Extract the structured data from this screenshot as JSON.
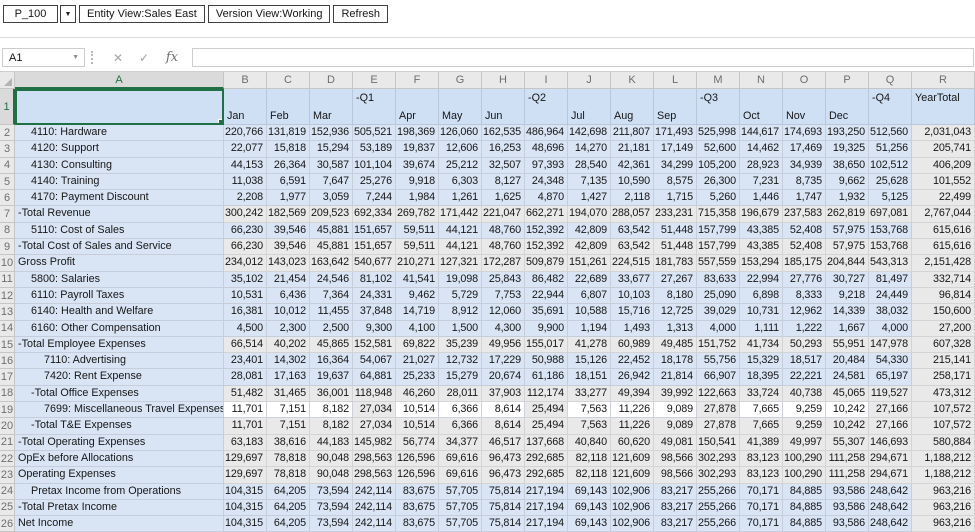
{
  "toolbar": {
    "pov": "P_100",
    "entity_button": "Entity View:Sales East",
    "version_button": "Version View:Working",
    "refresh_button": "Refresh"
  },
  "icons": {
    "pov_arrow": "▼",
    "namebox_arrow": "▼",
    "cancel": "✕",
    "confirm": "✓",
    "fx": "fx"
  },
  "formula_bar": {
    "cell_reference": "A1",
    "formula_value": ""
  },
  "colors": {
    "selection_green": "#1F7145",
    "fill_blue": "#D9E5F5",
    "fill_header_blue": "#CFE0F5",
    "fill_gray": "#E9E9E9",
    "fill_white": "#FFFFFF"
  },
  "grid": {
    "col_a": "A",
    "row1_number": "1",
    "columns": [
      {
        "letter": "B",
        "top": "",
        "bottom": "Jan"
      },
      {
        "letter": "C",
        "top": "",
        "bottom": "Feb"
      },
      {
        "letter": "D",
        "top": "",
        "bottom": "Mar"
      },
      {
        "letter": "E",
        "top": "-Q1",
        "bottom": ""
      },
      {
        "letter": "F",
        "top": "",
        "bottom": "Apr"
      },
      {
        "letter": "G",
        "top": "",
        "bottom": "May"
      },
      {
        "letter": "H",
        "top": "",
        "bottom": "Jun"
      },
      {
        "letter": "I",
        "top": "-Q2",
        "bottom": ""
      },
      {
        "letter": "J",
        "top": "",
        "bottom": "Jul"
      },
      {
        "letter": "K",
        "top": "",
        "bottom": "Aug"
      },
      {
        "letter": "L",
        "top": "",
        "bottom": "Sep"
      },
      {
        "letter": "M",
        "top": "-Q3",
        "bottom": ""
      },
      {
        "letter": "N",
        "top": "",
        "bottom": "Oct"
      },
      {
        "letter": "O",
        "top": "",
        "bottom": "Nov"
      },
      {
        "letter": "P",
        "top": "",
        "bottom": "Dec"
      },
      {
        "letter": "Q",
        "top": "-Q4",
        "bottom": ""
      },
      {
        "letter": "R",
        "top": "YearTotal",
        "bottom": ""
      }
    ],
    "rows": [
      {
        "number": "2",
        "label": "4110: Hardware",
        "indent": 1,
        "shade": "blue",
        "values": [
          "220,766",
          "131,819",
          "152,936",
          "505,521",
          "198,369",
          "126,060",
          "162,535",
          "486,964",
          "142,698",
          "211,807",
          "171,493",
          "525,998",
          "144,617",
          "174,693",
          "193,250",
          "512,560",
          "2,031,043"
        ]
      },
      {
        "number": "3",
        "label": "4120: Support",
        "indent": 1,
        "shade": "blue",
        "values": [
          "22,077",
          "15,818",
          "15,294",
          "53,189",
          "19,837",
          "12,606",
          "16,253",
          "48,696",
          "14,270",
          "21,181",
          "17,149",
          "52,600",
          "14,462",
          "17,469",
          "19,325",
          "51,256",
          "205,741"
        ]
      },
      {
        "number": "4",
        "label": "4130: Consulting",
        "indent": 1,
        "shade": "blue",
        "values": [
          "44,153",
          "26,364",
          "30,587",
          "101,104",
          "39,674",
          "25,212",
          "32,507",
          "97,393",
          "28,540",
          "42,361",
          "34,299",
          "105,200",
          "28,923",
          "34,939",
          "38,650",
          "102,512",
          "406,209"
        ]
      },
      {
        "number": "5",
        "label": "4140: Training",
        "indent": 1,
        "shade": "blue",
        "values": [
          "11,038",
          "6,591",
          "7,647",
          "25,276",
          "9,918",
          "6,303",
          "8,127",
          "24,348",
          "7,135",
          "10,590",
          "8,575",
          "26,300",
          "7,231",
          "8,735",
          "9,662",
          "25,628",
          "101,552"
        ]
      },
      {
        "number": "6",
        "label": "4170: Payment Discount",
        "indent": 1,
        "shade": "blue",
        "values": [
          "2,208",
          "1,977",
          "3,059",
          "7,244",
          "1,984",
          "1,261",
          "1,625",
          "4,870",
          "1,427",
          "2,118",
          "1,715",
          "5,260",
          "1,446",
          "1,747",
          "1,932",
          "5,125",
          "22,499"
        ]
      },
      {
        "number": "7",
        "label": "-Total Revenue",
        "indent": 0,
        "shade": "gray",
        "values": [
          "300,242",
          "182,569",
          "209,523",
          "692,334",
          "269,782",
          "171,442",
          "221,047",
          "662,271",
          "194,070",
          "288,057",
          "233,231",
          "715,358",
          "196,679",
          "237,583",
          "262,819",
          "697,081",
          "2,767,044"
        ]
      },
      {
        "number": "8",
        "label": "5110: Cost of Sales",
        "indent": 1,
        "shade": "blue",
        "values": [
          "66,230",
          "39,546",
          "45,881",
          "151,657",
          "59,511",
          "44,121",
          "48,760",
          "152,392",
          "42,809",
          "63,542",
          "51,448",
          "157,799",
          "43,385",
          "52,408",
          "57,975",
          "153,768",
          "615,616"
        ]
      },
      {
        "number": "9",
        "label": "-Total Cost of Sales and Service",
        "indent": 0,
        "shade": "gray",
        "values": [
          "66,230",
          "39,546",
          "45,881",
          "151,657",
          "59,511",
          "44,121",
          "48,760",
          "152,392",
          "42,809",
          "63,542",
          "51,448",
          "157,799",
          "43,385",
          "52,408",
          "57,975",
          "153,768",
          "615,616"
        ]
      },
      {
        "number": "10",
        "label": "Gross Profit",
        "indent": 0,
        "shade": "gray",
        "values": [
          "234,012",
          "143,023",
          "163,642",
          "540,677",
          "210,271",
          "127,321",
          "172,287",
          "509,879",
          "151,261",
          "224,515",
          "181,783",
          "557,559",
          "153,294",
          "185,175",
          "204,844",
          "543,313",
          "2,151,428"
        ]
      },
      {
        "number": "11",
        "label": "5800: Salaries",
        "indent": 1,
        "shade": "blue",
        "values": [
          "35,102",
          "21,454",
          "24,546",
          "81,102",
          "41,541",
          "19,098",
          "25,843",
          "86,482",
          "22,689",
          "33,677",
          "27,267",
          "83,633",
          "22,994",
          "27,776",
          "30,727",
          "81,497",
          "332,714"
        ]
      },
      {
        "number": "12",
        "label": "6110: Payroll Taxes",
        "indent": 1,
        "shade": "blue",
        "values": [
          "10,531",
          "6,436",
          "7,364",
          "24,331",
          "9,462",
          "5,729",
          "7,753",
          "22,944",
          "6,807",
          "10,103",
          "8,180",
          "25,090",
          "6,898",
          "8,333",
          "9,218",
          "24,449",
          "96,814"
        ]
      },
      {
        "number": "13",
        "label": "6140: Health and Welfare",
        "indent": 1,
        "shade": "blue",
        "values": [
          "16,381",
          "10,012",
          "11,455",
          "37,848",
          "14,719",
          "8,912",
          "12,060",
          "35,691",
          "10,588",
          "15,716",
          "12,725",
          "39,029",
          "10,731",
          "12,962",
          "14,339",
          "38,032",
          "150,600"
        ]
      },
      {
        "number": "14",
        "label": "6160: Other Compensation",
        "indent": 1,
        "shade": "blue",
        "values": [
          "4,500",
          "2,300",
          "2,500",
          "9,300",
          "4,100",
          "1,500",
          "4,300",
          "9,900",
          "1,194",
          "1,493",
          "1,313",
          "4,000",
          "1,111",
          "1,222",
          "1,667",
          "4,000",
          "27,200"
        ]
      },
      {
        "number": "15",
        "label": "-Total Employee Expenses",
        "indent": 0,
        "shade": "gray",
        "values": [
          "66,514",
          "40,202",
          "45,865",
          "152,581",
          "69,822",
          "35,239",
          "49,956",
          "155,017",
          "41,278",
          "60,989",
          "49,485",
          "151,752",
          "41,734",
          "50,293",
          "55,951",
          "147,978",
          "607,328"
        ]
      },
      {
        "number": "16",
        "label": "7110: Advertising",
        "indent": 2,
        "shade": "blue",
        "values": [
          "23,401",
          "14,302",
          "16,364",
          "54,067",
          "21,027",
          "12,732",
          "17,229",
          "50,988",
          "15,126",
          "22,452",
          "18,178",
          "55,756",
          "15,329",
          "18,517",
          "20,484",
          "54,330",
          "215,141"
        ]
      },
      {
        "number": "17",
        "label": "7420: Rent Expense",
        "indent": 2,
        "shade": "blue",
        "values": [
          "28,081",
          "17,163",
          "19,637",
          "64,881",
          "25,233",
          "15,279",
          "20,674",
          "61,186",
          "18,151",
          "26,942",
          "21,814",
          "66,907",
          "18,395",
          "22,221",
          "24,581",
          "65,197",
          "258,171"
        ]
      },
      {
        "number": "18",
        "label": "-Total Office Expenses",
        "indent": 1,
        "shade": "gray",
        "values": [
          "51,482",
          "31,465",
          "36,001",
          "118,948",
          "46,260",
          "28,011",
          "37,903",
          "112,174",
          "33,277",
          "49,394",
          "39,992",
          "122,663",
          "33,724",
          "40,738",
          "45,065",
          "119,527",
          "473,312"
        ]
      },
      {
        "number": "19",
        "label": "7699: Miscellaneous Travel Expenses",
        "indent": 2,
        "shade": "input",
        "values": [
          "11,701",
          "7,151",
          "8,182",
          "27,034",
          "10,514",
          "6,366",
          "8,614",
          "25,494",
          "7,563",
          "11,226",
          "9,089",
          "27,878",
          "7,665",
          "9,259",
          "10,242",
          "27,166",
          "107,572"
        ]
      },
      {
        "number": "20",
        "label": "-Total T&E Expenses",
        "indent": 1,
        "shade": "gray",
        "values": [
          "11,701",
          "7,151",
          "8,182",
          "27,034",
          "10,514",
          "6,366",
          "8,614",
          "25,494",
          "7,563",
          "11,226",
          "9,089",
          "27,878",
          "7,665",
          "9,259",
          "10,242",
          "27,166",
          "107,572"
        ]
      },
      {
        "number": "21",
        "label": "-Total Operating Expenses",
        "indent": 0,
        "shade": "gray",
        "values": [
          "63,183",
          "38,616",
          "44,183",
          "145,982",
          "56,774",
          "34,377",
          "46,517",
          "137,668",
          "40,840",
          "60,620",
          "49,081",
          "150,541",
          "41,389",
          "49,997",
          "55,307",
          "146,693",
          "580,884"
        ]
      },
      {
        "number": "22",
        "label": "OpEx before Allocations",
        "indent": 0,
        "shade": "gray",
        "values": [
          "129,697",
          "78,818",
          "90,048",
          "298,563",
          "126,596",
          "69,616",
          "96,473",
          "292,685",
          "82,118",
          "121,609",
          "98,566",
          "302,293",
          "83,123",
          "100,290",
          "111,258",
          "294,671",
          "1,188,212"
        ]
      },
      {
        "number": "23",
        "label": "Operating Expenses",
        "indent": 0,
        "shade": "gray",
        "values": [
          "129,697",
          "78,818",
          "90,048",
          "298,563",
          "126,596",
          "69,616",
          "96,473",
          "292,685",
          "82,118",
          "121,609",
          "98,566",
          "302,293",
          "83,123",
          "100,290",
          "111,258",
          "294,671",
          "1,188,212"
        ]
      },
      {
        "number": "24",
        "label": "Pretax Income from Operations",
        "indent": 1,
        "shade": "blue",
        "values": [
          "104,315",
          "64,205",
          "73,594",
          "242,114",
          "83,675",
          "57,705",
          "75,814",
          "217,194",
          "69,143",
          "102,906",
          "83,217",
          "255,266",
          "70,171",
          "84,885",
          "93,586",
          "248,642",
          "963,216"
        ]
      },
      {
        "number": "25",
        "label": "-Total Pretax Income",
        "indent": 0,
        "shade": "blue",
        "values": [
          "104,315",
          "64,205",
          "73,594",
          "242,114",
          "83,675",
          "57,705",
          "75,814",
          "217,194",
          "69,143",
          "102,906",
          "83,217",
          "255,266",
          "70,171",
          "84,885",
          "93,586",
          "248,642",
          "963,216"
        ]
      },
      {
        "number": "26",
        "label": "Net Income",
        "indent": 0,
        "shade": "blue",
        "values": [
          "104,315",
          "64,205",
          "73,594",
          "242,114",
          "83,675",
          "57,705",
          "75,814",
          "217,194",
          "69,143",
          "102,906",
          "83,217",
          "255,266",
          "70,171",
          "84,885",
          "93,586",
          "248,642",
          "963,216"
        ]
      }
    ]
  }
}
